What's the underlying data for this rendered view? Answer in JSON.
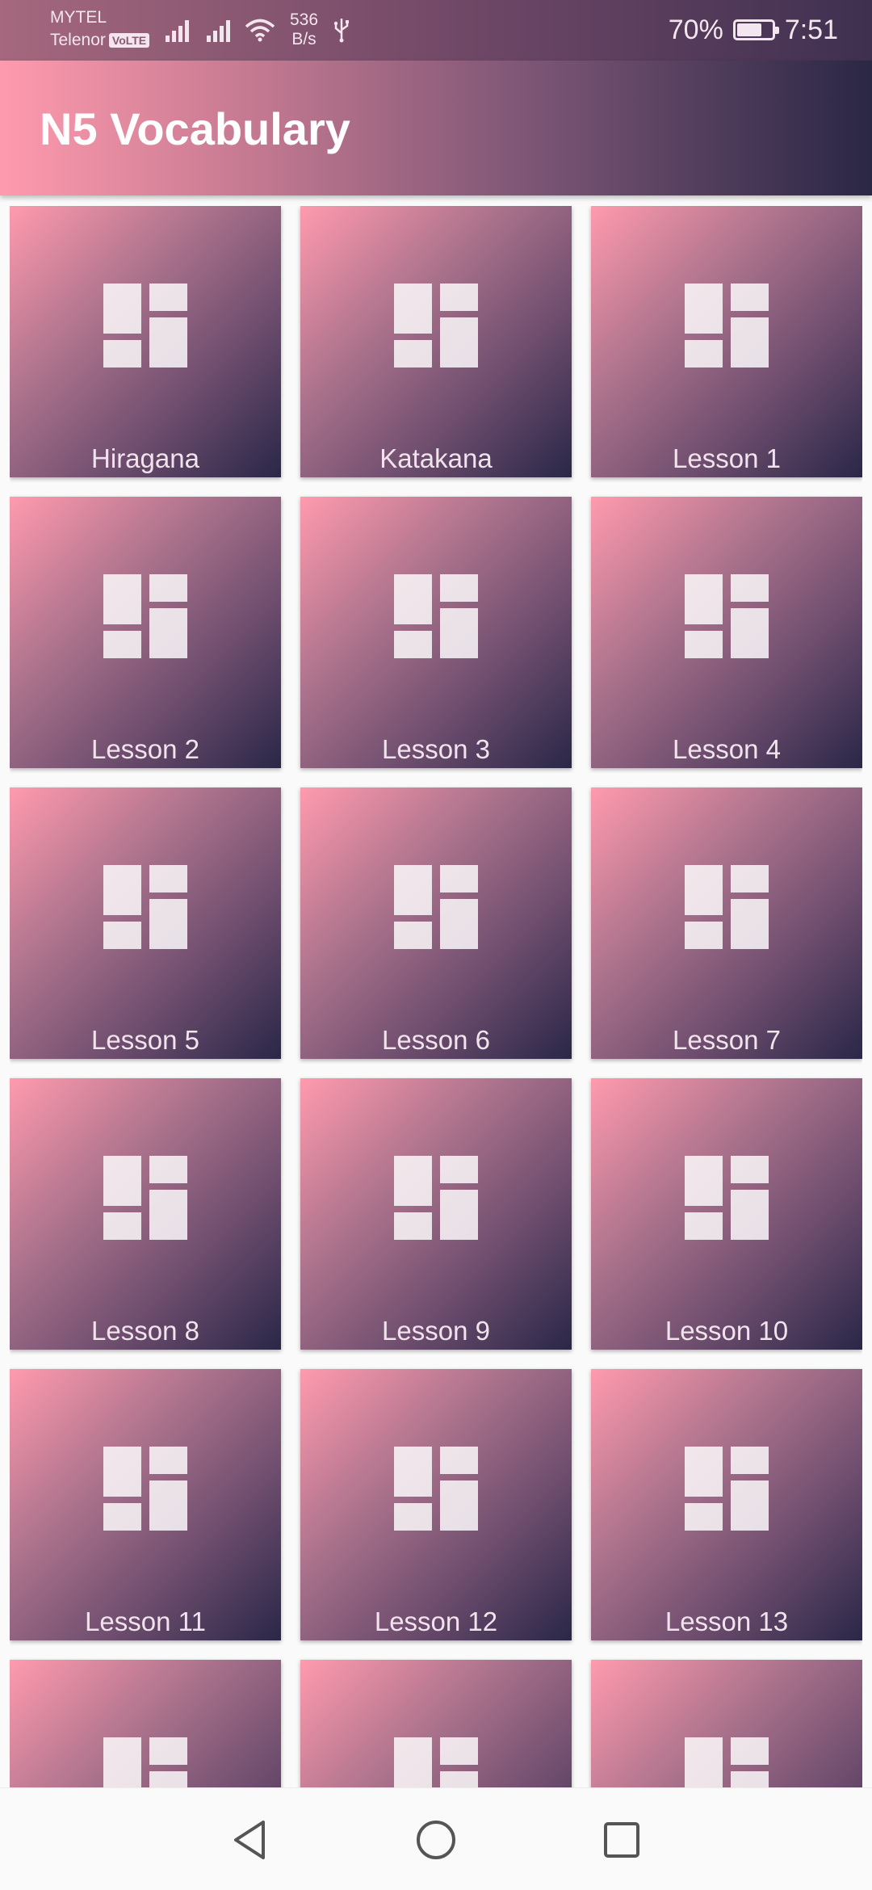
{
  "status_bar": {
    "carrier_1": "MYTEL",
    "carrier_2": "Telenor",
    "volte_badge": "VoLTE",
    "net_speed_value": "536",
    "net_speed_unit": "B/s",
    "battery_percent": "70%",
    "time": "7:51",
    "icons": [
      "signal-icon",
      "signal-icon",
      "wifi-icon",
      "usb-icon",
      "battery-charging-icon"
    ]
  },
  "app_bar": {
    "title": "N5 Vocabulary"
  },
  "tiles": [
    {
      "label": "Hiragana",
      "icon": "dashboard-icon"
    },
    {
      "label": "Katakana",
      "icon": "dashboard-icon"
    },
    {
      "label": "Lesson 1",
      "icon": "dashboard-icon"
    },
    {
      "label": "Lesson 2",
      "icon": "dashboard-icon"
    },
    {
      "label": "Lesson 3",
      "icon": "dashboard-icon"
    },
    {
      "label": "Lesson 4",
      "icon": "dashboard-icon"
    },
    {
      "label": "Lesson 5",
      "icon": "dashboard-icon"
    },
    {
      "label": "Lesson 6",
      "icon": "dashboard-icon"
    },
    {
      "label": "Lesson 7",
      "icon": "dashboard-icon"
    },
    {
      "label": "Lesson 8",
      "icon": "dashboard-icon"
    },
    {
      "label": "Lesson 9",
      "icon": "dashboard-icon"
    },
    {
      "label": "Lesson 10",
      "icon": "dashboard-icon"
    },
    {
      "label": "Lesson 11",
      "icon": "dashboard-icon"
    },
    {
      "label": "Lesson 12",
      "icon": "dashboard-icon"
    },
    {
      "label": "Lesson 13",
      "icon": "dashboard-icon"
    },
    {
      "label": "",
      "icon": "dashboard-icon"
    },
    {
      "label": "",
      "icon": "dashboard-icon"
    },
    {
      "label": "",
      "icon": "dashboard-icon"
    }
  ],
  "nav_bar": {
    "buttons": [
      "back-icon",
      "home-icon",
      "recents-icon"
    ]
  },
  "colors": {
    "tile_gradient_start": "#ff9aae",
    "tile_gradient_end": "#2a2748",
    "appbar_gradient_start": "#ff9aae",
    "appbar_gradient_end": "#2a2745",
    "tile_text": "#f1e3ec"
  }
}
